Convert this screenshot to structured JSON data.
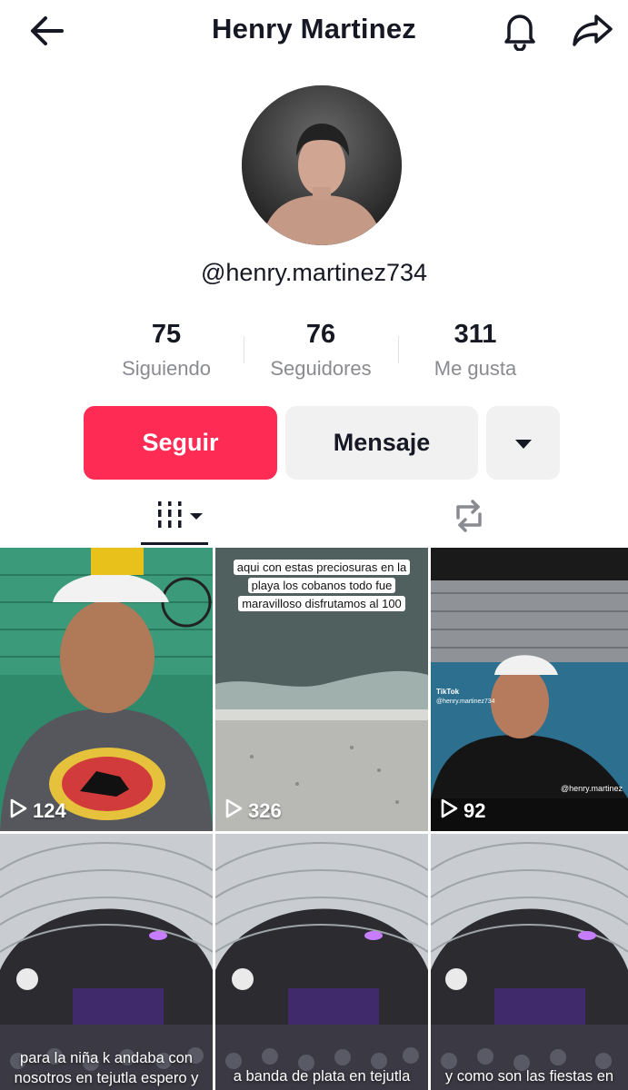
{
  "header": {
    "title": "Henry Martinez"
  },
  "profile": {
    "handle": "@henry.martinez734"
  },
  "stats": [
    {
      "value": "75",
      "label": "Siguiendo"
    },
    {
      "value": "76",
      "label": "Seguidores"
    },
    {
      "value": "311",
      "label": "Me gusta"
    }
  ],
  "actions": {
    "follow": "Seguir",
    "message": "Mensaje"
  },
  "videos": [
    {
      "views": "124"
    },
    {
      "views": "326",
      "caption": "aqui con estas preciosuras en la playa los cobanos todo fue maravilloso disfrutamos al 100"
    },
    {
      "views": "92",
      "watermark_brand": "TikTok",
      "watermark_handle": "@henry.martinez734",
      "watermark_bottom": "@henry.martinez"
    },
    {
      "caption": "para la niña k andaba con nosotros en tejutla espero y"
    },
    {
      "caption": "a banda de plata en tejutla"
    },
    {
      "caption": "y como son las fiestas en"
    }
  ],
  "colors": {
    "accent": "#fe2c55",
    "secondary_button": "#f1f1f2",
    "muted_text": "#8a8b91"
  },
  "icons": [
    "back-arrow-icon",
    "bell-icon",
    "share-icon",
    "dropdown-caret-icon",
    "videos-grid-icon",
    "repost-icon",
    "play-icon"
  ]
}
